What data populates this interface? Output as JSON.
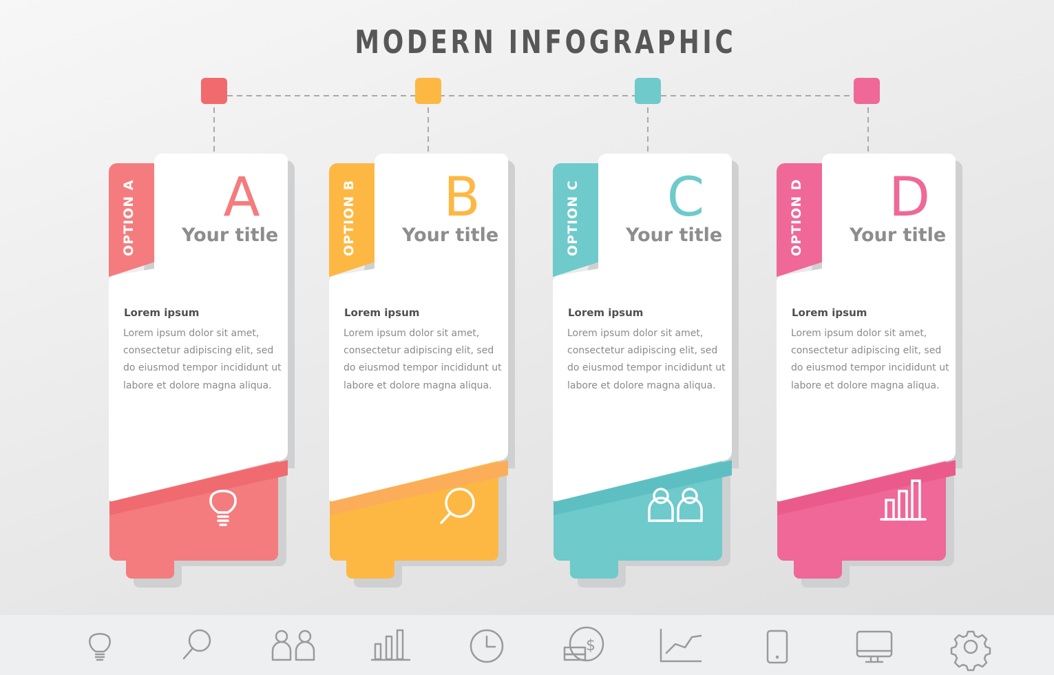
{
  "header": {
    "title": "MODERN INFOGRAPHIC"
  },
  "colors": {
    "option_a": "#f47c7e",
    "option_b": "#fdb844",
    "option_c": "#6ecacb",
    "option_d": "#ef6898",
    "title_text": "#575757",
    "card_title_text": "#8d8d8d",
    "icon_gray": "#9a9a9a"
  },
  "timeline": {
    "nodes": [
      {
        "name": "node-a",
        "color": "#f06a6e"
      },
      {
        "name": "node-b",
        "color": "#fdb844"
      },
      {
        "name": "node-c",
        "color": "#6ecacb"
      },
      {
        "name": "node-d",
        "color": "#ef6898"
      }
    ]
  },
  "cards": [
    {
      "tab_label": "OPTION A",
      "letter": "A",
      "title": "Your title",
      "body_heading": "Lorem ipsum",
      "body_text": "Lorem ipsum dolor sit amet, consectetur adipiscing elit, sed do eiusmod tempor incididunt ut labore et dolore magna aliqua.",
      "icon": "lightbulb-icon",
      "color": "#f47c7e",
      "color_dark": "#ef6b70"
    },
    {
      "tab_label": "OPTION B",
      "letter": "B",
      "title": "Your title",
      "body_heading": "Lorem ipsum",
      "body_text": "Lorem ipsum dolor sit amet, consectetur adipiscing elit, sed do eiusmod tempor incididunt ut labore et dolore magna aliqua.",
      "icon": "search-icon",
      "color": "#fdb844",
      "color_dark": "#fbad5a"
    },
    {
      "tab_label": "OPTION C",
      "letter": "C",
      "title": "Your title",
      "body_heading": "Lorem ipsum",
      "body_text": "Lorem ipsum dolor sit amet, consectetur adipiscing elit, sed do eiusmod tempor incididunt ut labore et dolore magna aliqua.",
      "icon": "users-icon",
      "color": "#6ecacb",
      "color_dark": "#5dbfc1"
    },
    {
      "tab_label": "OPTION D",
      "letter": "D",
      "title": "Your title",
      "body_heading": "Lorem ipsum",
      "body_text": "Lorem ipsum dolor sit amet, consectetur adipiscing elit, sed do eiusmod tempor incididunt ut labore et dolore magna aliqua.",
      "icon": "bar-chart-icon",
      "color": "#ef6898",
      "color_dark": "#ea5b8c"
    }
  ],
  "icon_strip": [
    "lightbulb-icon",
    "search-icon",
    "users-icon",
    "bar-chart-icon",
    "clock-icon",
    "money-icon",
    "line-chart-icon",
    "smartphone-icon",
    "monitor-icon",
    "gear-icon"
  ]
}
